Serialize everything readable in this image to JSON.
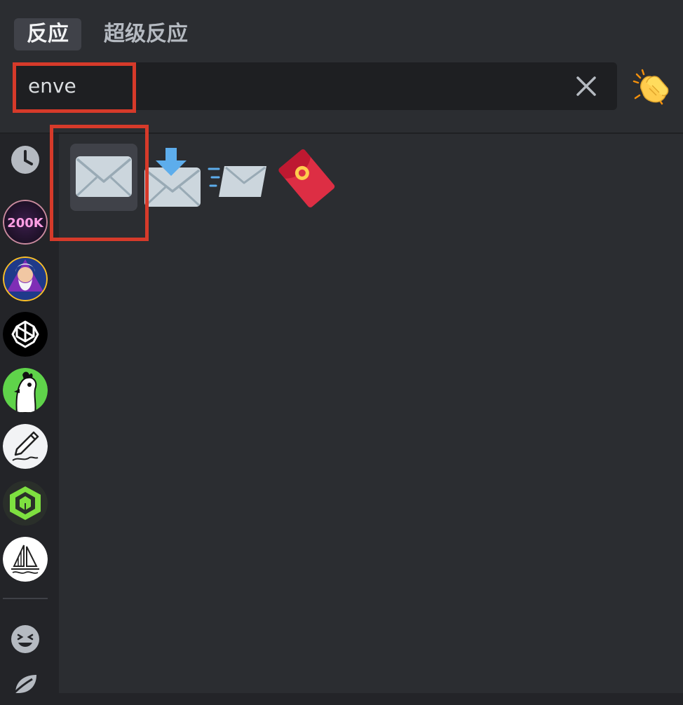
{
  "tabs": [
    {
      "label": "反应",
      "active": true
    },
    {
      "label": "超级反应",
      "active": false
    }
  ],
  "search": {
    "value": "enve"
  },
  "sidebar": {
    "categories": [
      {
        "name": "recent"
      },
      {
        "name": "server-200k",
        "badge": "200K"
      },
      {
        "name": "server-wizard"
      },
      {
        "name": "server-openai"
      },
      {
        "name": "server-chicken"
      },
      {
        "name": "server-pencil"
      },
      {
        "name": "server-cube"
      },
      {
        "name": "server-sailboat"
      },
      {
        "name": "people"
      },
      {
        "name": "nature"
      }
    ]
  },
  "results": [
    {
      "name": "envelope",
      "icon": "envelope-icon"
    },
    {
      "name": "envelope_with_arrow",
      "icon": "envelope-arrow-icon"
    },
    {
      "name": "incoming_envelope",
      "icon": "incoming-envelope-icon"
    },
    {
      "name": "red_envelope",
      "icon": "red-envelope-icon"
    }
  ],
  "colors": {
    "background": "#2b2d31",
    "sidebar": "#232428",
    "search_bg": "#1e1f22",
    "highlight": "#d63a2a",
    "hover": "#404249"
  }
}
